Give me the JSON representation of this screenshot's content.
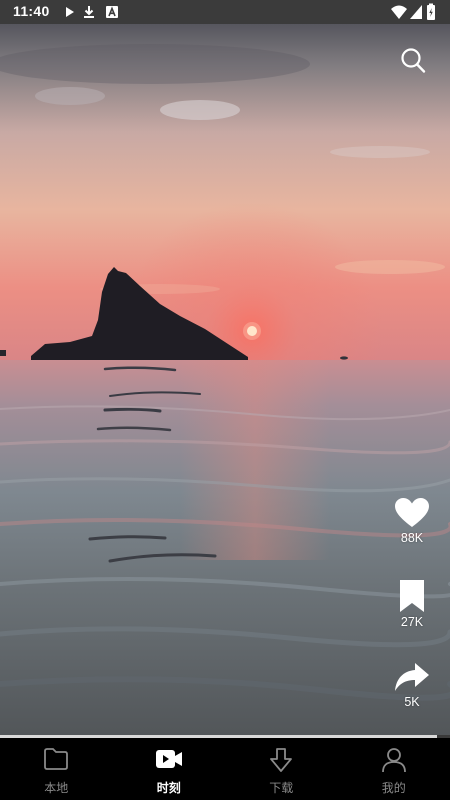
{
  "status_bar": {
    "time": "11:40",
    "left_icons": [
      "play-store-icon",
      "download-icon",
      "text-a-icon"
    ],
    "right_icons": [
      "wifi-icon",
      "signal-icon",
      "battery-icon"
    ]
  },
  "video": {
    "progress": 0.97
  },
  "top_actions": {
    "search_icon": "search-icon"
  },
  "side_actions": {
    "like": {
      "icon": "heart-icon",
      "count": "88K"
    },
    "favorite": {
      "icon": "bookmark-icon",
      "count": "27K"
    },
    "share": {
      "icon": "share-icon",
      "count": "5K"
    }
  },
  "bottom_nav": {
    "items": [
      {
        "label": "本地",
        "icon": "folder-icon",
        "active": false
      },
      {
        "label": "时刻",
        "icon": "video-icon",
        "active": true
      },
      {
        "label": "下载",
        "icon": "download-arrow-icon",
        "active": false
      },
      {
        "label": "我的",
        "icon": "person-icon",
        "active": false
      }
    ]
  },
  "colors": {
    "status_bar_bg": "#3b3b3b",
    "nav_bg": "#000000",
    "nav_active": "#ffffff",
    "nav_inactive": "#8a8a8a",
    "sun": "#fff1d6"
  }
}
